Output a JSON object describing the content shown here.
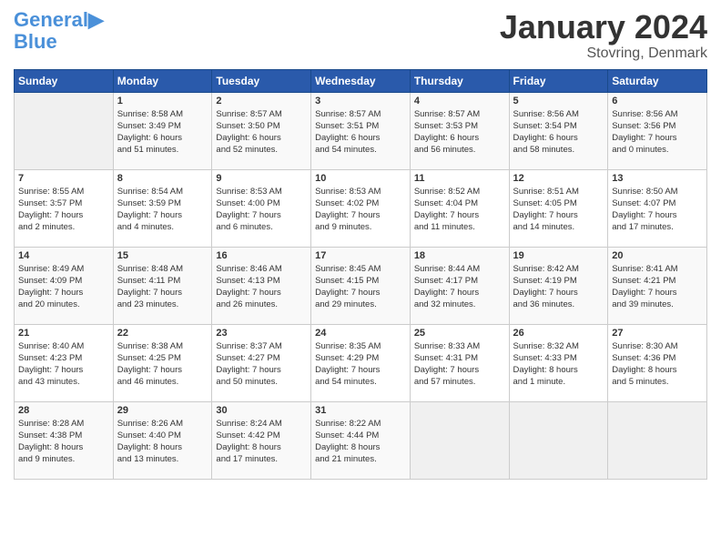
{
  "header": {
    "logo": "GeneralBlue",
    "month": "January 2024",
    "location": "Stovring, Denmark"
  },
  "days_of_week": [
    "Sunday",
    "Monday",
    "Tuesday",
    "Wednesday",
    "Thursday",
    "Friday",
    "Saturday"
  ],
  "weeks": [
    [
      {
        "day": "",
        "info": ""
      },
      {
        "day": "1",
        "info": "Sunrise: 8:58 AM\nSunset: 3:49 PM\nDaylight: 6 hours\nand 51 minutes."
      },
      {
        "day": "2",
        "info": "Sunrise: 8:57 AM\nSunset: 3:50 PM\nDaylight: 6 hours\nand 52 minutes."
      },
      {
        "day": "3",
        "info": "Sunrise: 8:57 AM\nSunset: 3:51 PM\nDaylight: 6 hours\nand 54 minutes."
      },
      {
        "day": "4",
        "info": "Sunrise: 8:57 AM\nSunset: 3:53 PM\nDaylight: 6 hours\nand 56 minutes."
      },
      {
        "day": "5",
        "info": "Sunrise: 8:56 AM\nSunset: 3:54 PM\nDaylight: 6 hours\nand 58 minutes."
      },
      {
        "day": "6",
        "info": "Sunrise: 8:56 AM\nSunset: 3:56 PM\nDaylight: 7 hours\nand 0 minutes."
      }
    ],
    [
      {
        "day": "7",
        "info": "Sunrise: 8:55 AM\nSunset: 3:57 PM\nDaylight: 7 hours\nand 2 minutes."
      },
      {
        "day": "8",
        "info": "Sunrise: 8:54 AM\nSunset: 3:59 PM\nDaylight: 7 hours\nand 4 minutes."
      },
      {
        "day": "9",
        "info": "Sunrise: 8:53 AM\nSunset: 4:00 PM\nDaylight: 7 hours\nand 6 minutes."
      },
      {
        "day": "10",
        "info": "Sunrise: 8:53 AM\nSunset: 4:02 PM\nDaylight: 7 hours\nand 9 minutes."
      },
      {
        "day": "11",
        "info": "Sunrise: 8:52 AM\nSunset: 4:04 PM\nDaylight: 7 hours\nand 11 minutes."
      },
      {
        "day": "12",
        "info": "Sunrise: 8:51 AM\nSunset: 4:05 PM\nDaylight: 7 hours\nand 14 minutes."
      },
      {
        "day": "13",
        "info": "Sunrise: 8:50 AM\nSunset: 4:07 PM\nDaylight: 7 hours\nand 17 minutes."
      }
    ],
    [
      {
        "day": "14",
        "info": "Sunrise: 8:49 AM\nSunset: 4:09 PM\nDaylight: 7 hours\nand 20 minutes."
      },
      {
        "day": "15",
        "info": "Sunrise: 8:48 AM\nSunset: 4:11 PM\nDaylight: 7 hours\nand 23 minutes."
      },
      {
        "day": "16",
        "info": "Sunrise: 8:46 AM\nSunset: 4:13 PM\nDaylight: 7 hours\nand 26 minutes."
      },
      {
        "day": "17",
        "info": "Sunrise: 8:45 AM\nSunset: 4:15 PM\nDaylight: 7 hours\nand 29 minutes."
      },
      {
        "day": "18",
        "info": "Sunrise: 8:44 AM\nSunset: 4:17 PM\nDaylight: 7 hours\nand 32 minutes."
      },
      {
        "day": "19",
        "info": "Sunrise: 8:42 AM\nSunset: 4:19 PM\nDaylight: 7 hours\nand 36 minutes."
      },
      {
        "day": "20",
        "info": "Sunrise: 8:41 AM\nSunset: 4:21 PM\nDaylight: 7 hours\nand 39 minutes."
      }
    ],
    [
      {
        "day": "21",
        "info": "Sunrise: 8:40 AM\nSunset: 4:23 PM\nDaylight: 7 hours\nand 43 minutes."
      },
      {
        "day": "22",
        "info": "Sunrise: 8:38 AM\nSunset: 4:25 PM\nDaylight: 7 hours\nand 46 minutes."
      },
      {
        "day": "23",
        "info": "Sunrise: 8:37 AM\nSunset: 4:27 PM\nDaylight: 7 hours\nand 50 minutes."
      },
      {
        "day": "24",
        "info": "Sunrise: 8:35 AM\nSunset: 4:29 PM\nDaylight: 7 hours\nand 54 minutes."
      },
      {
        "day": "25",
        "info": "Sunrise: 8:33 AM\nSunset: 4:31 PM\nDaylight: 7 hours\nand 57 minutes."
      },
      {
        "day": "26",
        "info": "Sunrise: 8:32 AM\nSunset: 4:33 PM\nDaylight: 8 hours\nand 1 minute."
      },
      {
        "day": "27",
        "info": "Sunrise: 8:30 AM\nSunset: 4:36 PM\nDaylight: 8 hours\nand 5 minutes."
      }
    ],
    [
      {
        "day": "28",
        "info": "Sunrise: 8:28 AM\nSunset: 4:38 PM\nDaylight: 8 hours\nand 9 minutes."
      },
      {
        "day": "29",
        "info": "Sunrise: 8:26 AM\nSunset: 4:40 PM\nDaylight: 8 hours\nand 13 minutes."
      },
      {
        "day": "30",
        "info": "Sunrise: 8:24 AM\nSunset: 4:42 PM\nDaylight: 8 hours\nand 17 minutes."
      },
      {
        "day": "31",
        "info": "Sunrise: 8:22 AM\nSunset: 4:44 PM\nDaylight: 8 hours\nand 21 minutes."
      },
      {
        "day": "",
        "info": ""
      },
      {
        "day": "",
        "info": ""
      },
      {
        "day": "",
        "info": ""
      }
    ]
  ]
}
